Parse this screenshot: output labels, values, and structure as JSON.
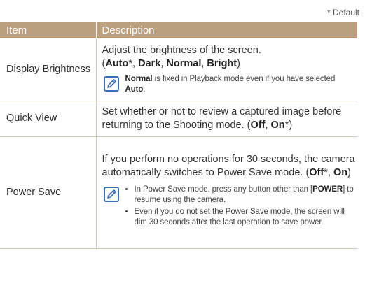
{
  "default_note": "* Default",
  "columns": {
    "item": "Item",
    "description": "Description"
  },
  "rows": [
    {
      "item": "Display Brightness",
      "desc_text": "Adjust the brightness of the screen.",
      "options": {
        "open": "(",
        "a": "Auto",
        "a_star": "*",
        "sep1": ", ",
        "b": "Dark",
        "sep2": ", ",
        "c": "Normal",
        "sep3": ", ",
        "d": "Bright",
        "close": ")"
      },
      "note": {
        "strong1": "Normal",
        "text1": " is fixed in Playback mode even if you have selected ",
        "strong2": "Auto",
        "text2": "."
      }
    },
    {
      "item": "Quick View",
      "desc_text": "Set whether or not to review a captured image before returning to the Shooting mode. ",
      "options": {
        "open": "(",
        "a": "Off",
        "sep1": ", ",
        "b": "On",
        "b_star": "*",
        "close": ")"
      }
    },
    {
      "item": "Power Save",
      "desc_text": "If you perform no operations for 30 seconds, the camera automatically switches to Power Save mode. ",
      "options": {
        "open": "(",
        "a": "Off",
        "a_star": "*",
        "sep1": ", ",
        "b": "On",
        "close": ")"
      },
      "note_items": [
        {
          "t1": "In Power Save mode, press any button other than [",
          "strong": "POWER",
          "t2": "] to resume using the camera."
        },
        {
          "t1": "Even if you do not set the Power Save mode, the screen will dim 30 seconds after the last operation to save power."
        }
      ]
    }
  ],
  "icons": {
    "note": "note-pencil-icon"
  },
  "colors": {
    "header_bg": "#bc9f7f",
    "header_text": "#ffffff",
    "rule": "#cfc5b8",
    "icon": "#3d6fb6"
  }
}
